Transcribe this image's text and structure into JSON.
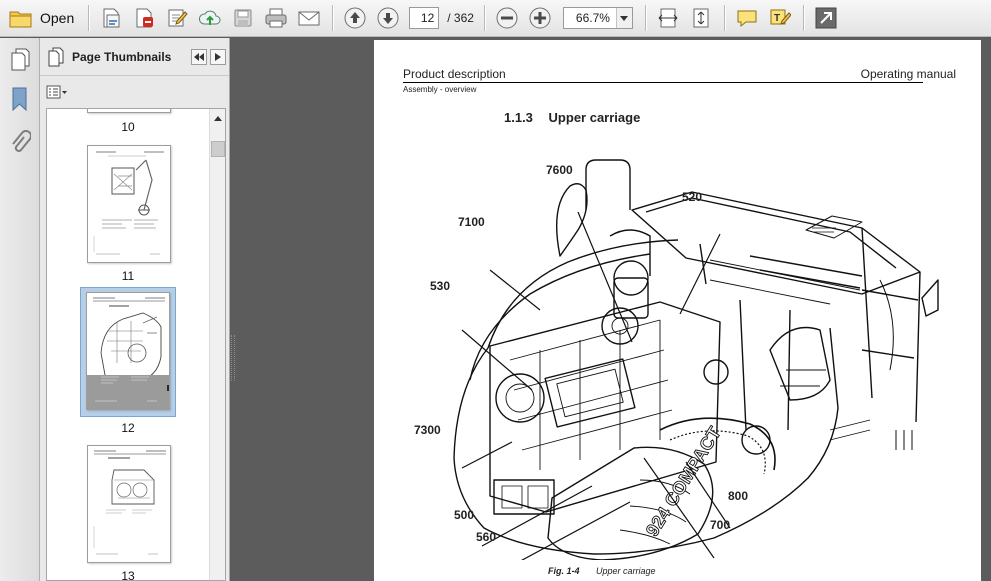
{
  "toolbar": {
    "open_label": "Open",
    "current_page": "12",
    "total_pages": "/ 362",
    "zoom": "66.7%"
  },
  "thumbnails": {
    "title": "Page Thumbnails",
    "items": [
      {
        "number": "10"
      },
      {
        "number": "11"
      },
      {
        "number": "12"
      },
      {
        "number": "13"
      }
    ]
  },
  "page": {
    "header_left": "Product description",
    "header_right": "Operating manual",
    "header_sub": "Assembly - overview",
    "section_number": "1.1.3",
    "section_title": "Upper carriage",
    "callouts": [
      "7600",
      "520",
      "7100",
      "530",
      "7300",
      "500",
      "560",
      "700",
      "800"
    ],
    "caption_label": "Fig. 1-4",
    "caption_text": "Upper carriage",
    "machine_marking": "924 COMPACT"
  },
  "colors": {
    "accent_blue": "#2f6db5",
    "selection": "#b7cfe6"
  }
}
